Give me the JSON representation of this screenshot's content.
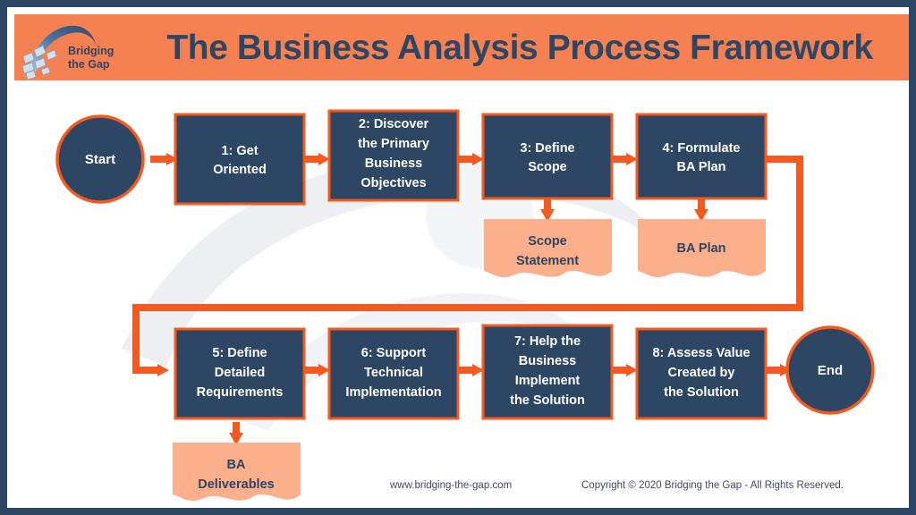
{
  "header": {
    "title": "The Business Analysis Process Framework",
    "logo": {
      "name": "bridging-the-gap-logo",
      "line1": "Bridging",
      "line2": "the Gap"
    },
    "background_color": "#f58152",
    "title_color": "#2d4663"
  },
  "colors": {
    "frame": "#2d4663",
    "orange": "#f4591f",
    "navy": "#2d4663",
    "document": "#fbaf8b",
    "white": "#ffffff",
    "watermark": "#eceef1"
  },
  "flow": {
    "terminators": [
      {
        "id": "start",
        "label": "Start"
      },
      {
        "id": "end",
        "label": "End"
      }
    ],
    "steps": [
      {
        "id": "step1",
        "lines": [
          "1: Get",
          "Oriented"
        ]
      },
      {
        "id": "step2",
        "lines": [
          "2: Discover",
          "the Primary",
          "Business",
          "Objectives"
        ]
      },
      {
        "id": "step3",
        "lines": [
          "3: Define",
          "Scope"
        ]
      },
      {
        "id": "step4",
        "lines": [
          "4: Formulate",
          "BA Plan"
        ]
      },
      {
        "id": "step5",
        "lines": [
          "5: Define",
          "Detailed",
          "Requirements"
        ]
      },
      {
        "id": "step6",
        "lines": [
          "6: Support",
          "Technical",
          "Implementation"
        ]
      },
      {
        "id": "step7",
        "lines": [
          "7: Help the",
          "Business",
          "Implement",
          "the Solution"
        ]
      },
      {
        "id": "step8",
        "lines": [
          "8: Assess Value",
          "Created by",
          "the Solution"
        ]
      }
    ],
    "documents": [
      {
        "id": "doc-scope-statement",
        "lines": [
          "Scope",
          "Statement"
        ],
        "from": "step3"
      },
      {
        "id": "doc-ba-plan",
        "lines": [
          "BA Plan"
        ],
        "from": "step4"
      },
      {
        "id": "doc-ba-deliverables",
        "lines": [
          "BA",
          "Deliverables"
        ],
        "from": "step5"
      }
    ]
  },
  "footer": {
    "website": "www.bridging-the-gap.com",
    "copyright": "Copyright © 2020 Bridging the Gap - All Rights Reserved."
  }
}
